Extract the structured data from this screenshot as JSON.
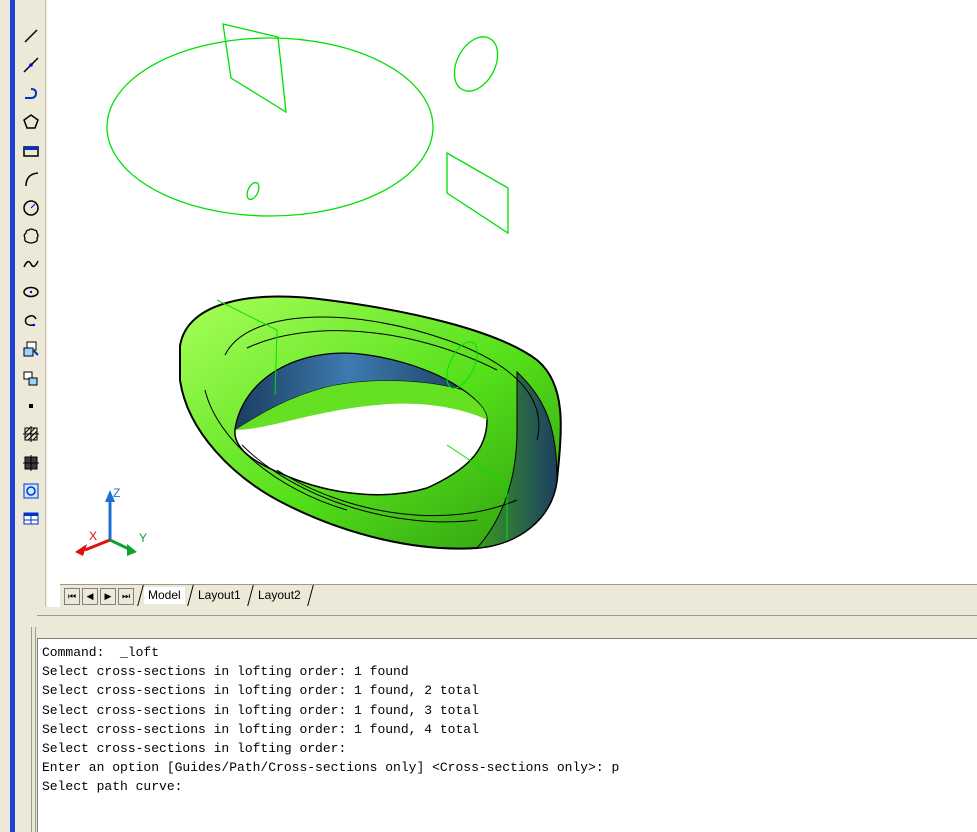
{
  "toolbar": {
    "tools": [
      {
        "name": "line-icon"
      },
      {
        "name": "construction-line-icon"
      },
      {
        "name": "polyline-icon"
      },
      {
        "name": "polygon-icon"
      },
      {
        "name": "rectangle-icon"
      },
      {
        "name": "arc-icon"
      },
      {
        "name": "circle-icon"
      },
      {
        "name": "revision-cloud-icon"
      },
      {
        "name": "spline-icon"
      },
      {
        "name": "ellipse-icon"
      },
      {
        "name": "ellipse-arc-icon"
      },
      {
        "name": "insert-block-icon"
      },
      {
        "name": "make-block-icon"
      },
      {
        "name": "point-icon"
      },
      {
        "name": "hatch-icon"
      },
      {
        "name": "gradient-icon"
      },
      {
        "name": "region-icon"
      },
      {
        "name": "table-icon"
      }
    ]
  },
  "ucs": {
    "x_label": "X",
    "y_label": "Y",
    "z_label": "Z"
  },
  "tabs": {
    "nav": [
      "⏮",
      "◀",
      "▶",
      "⏭"
    ],
    "items": [
      {
        "label": "Model",
        "active": true
      },
      {
        "label": "Layout1",
        "active": false
      },
      {
        "label": "Layout2",
        "active": false
      }
    ]
  },
  "command": {
    "lines": [
      "Command:  _loft",
      "Select cross-sections in lofting order: 1 found",
      "Select cross-sections in lofting order: 1 found, 2 total",
      "Select cross-sections in lofting order: 1 found, 3 total",
      "Select cross-sections in lofting order: 1 found, 4 total",
      "Select cross-sections in lofting order:",
      "Enter an option [Guides/Path/Cross-sections only] <Cross-sections only>: p",
      "Select path curve:"
    ]
  },
  "colors": {
    "wireframe": "#00e000",
    "solid_light": "#8cff3a",
    "solid_mid": "#44d414",
    "solid_dark": "#2a5f8f",
    "frame_blue": "#1f3fd6"
  }
}
